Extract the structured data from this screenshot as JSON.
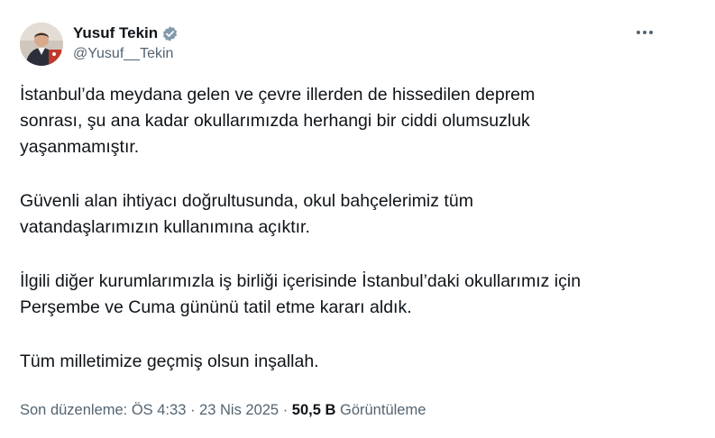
{
  "author": {
    "display_name": "Yusuf Tekin",
    "handle": "@Yusuf__Tekin",
    "verified": true,
    "verified_badge_color": "#829aab"
  },
  "more_icon": "more-horizontal-icon",
  "tweet": {
    "paragraphs": [
      "İstanbul’da meydana gelen ve çevre illerden de hissedilen deprem\nsonrası, şu ana kadar okullarımızda herhangi bir ciddi olumsuzluk\nyaşanmamıştır.",
      "Güvenli alan ihtiyacı doğrultusunda, okul bahçelerimiz tüm\nvatandaşlarımızın kullanımına açıktır.",
      "İlgili diğer kurumlarımızla iş birliği içerisinde İstanbul’daki okullarımız için\nPerşembe ve Cuma gününü tatil etme kararı aldık.",
      "Tüm milletimize geçmiş olsun inşallah."
    ]
  },
  "meta": {
    "edited_label": "Son düzenleme: ÖS 4:33",
    "separator": " · ",
    "date": "23 Nis 2025",
    "views_count": "50,5 B",
    "views_label": "Görüntüleme"
  }
}
